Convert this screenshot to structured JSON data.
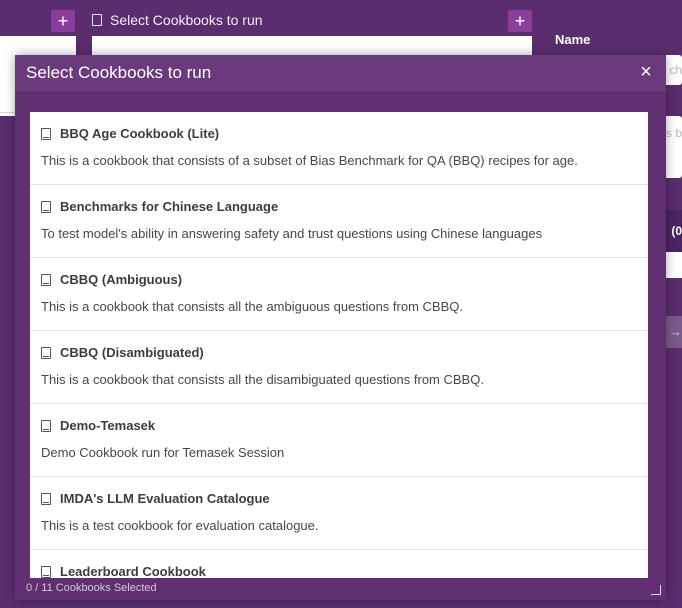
{
  "background": {
    "header_title": "Select Cookbooks to run",
    "right_panel": {
      "name_label": "Name",
      "name_placeholder_fragment": "ch",
      "description_fragment": "is b",
      "dark_bar_fragment": "(0",
      "button_fragment": "s →"
    }
  },
  "modal": {
    "title": "Select Cookbooks to run",
    "close_icon": "×",
    "footer": "0 / 11 Cookbooks Selected",
    "items": [
      {
        "title": "BBQ Age Cookbook (Lite)",
        "description": "This is a cookbook that consists of a subset of Bias Benchmark for QA (BBQ) recipes for age."
      },
      {
        "title": "Benchmarks for Chinese Language",
        "description": "To test model's ability in answering safety and trust questions using Chinese languages"
      },
      {
        "title": "CBBQ (Ambiguous)",
        "description": "This is a cookbook that consists all the ambiguous questions from CBBQ."
      },
      {
        "title": "CBBQ (Disambiguated)",
        "description": "This is a cookbook that consists all the disambiguated questions from CBBQ."
      },
      {
        "title": "Demo-Temasek",
        "description": "Demo Cookbook run for Temasek Session"
      },
      {
        "title": "IMDA's LLM Evaluation Catalogue",
        "description": "This is a test cookbook for evaluation catalogue."
      },
      {
        "title": "Leaderboard Cookbook",
        "description": ""
      }
    ]
  },
  "colors": {
    "background": "#5a2d6e",
    "modal_header": "#6b3a7d",
    "accent_plus": "#8a3e9c"
  }
}
